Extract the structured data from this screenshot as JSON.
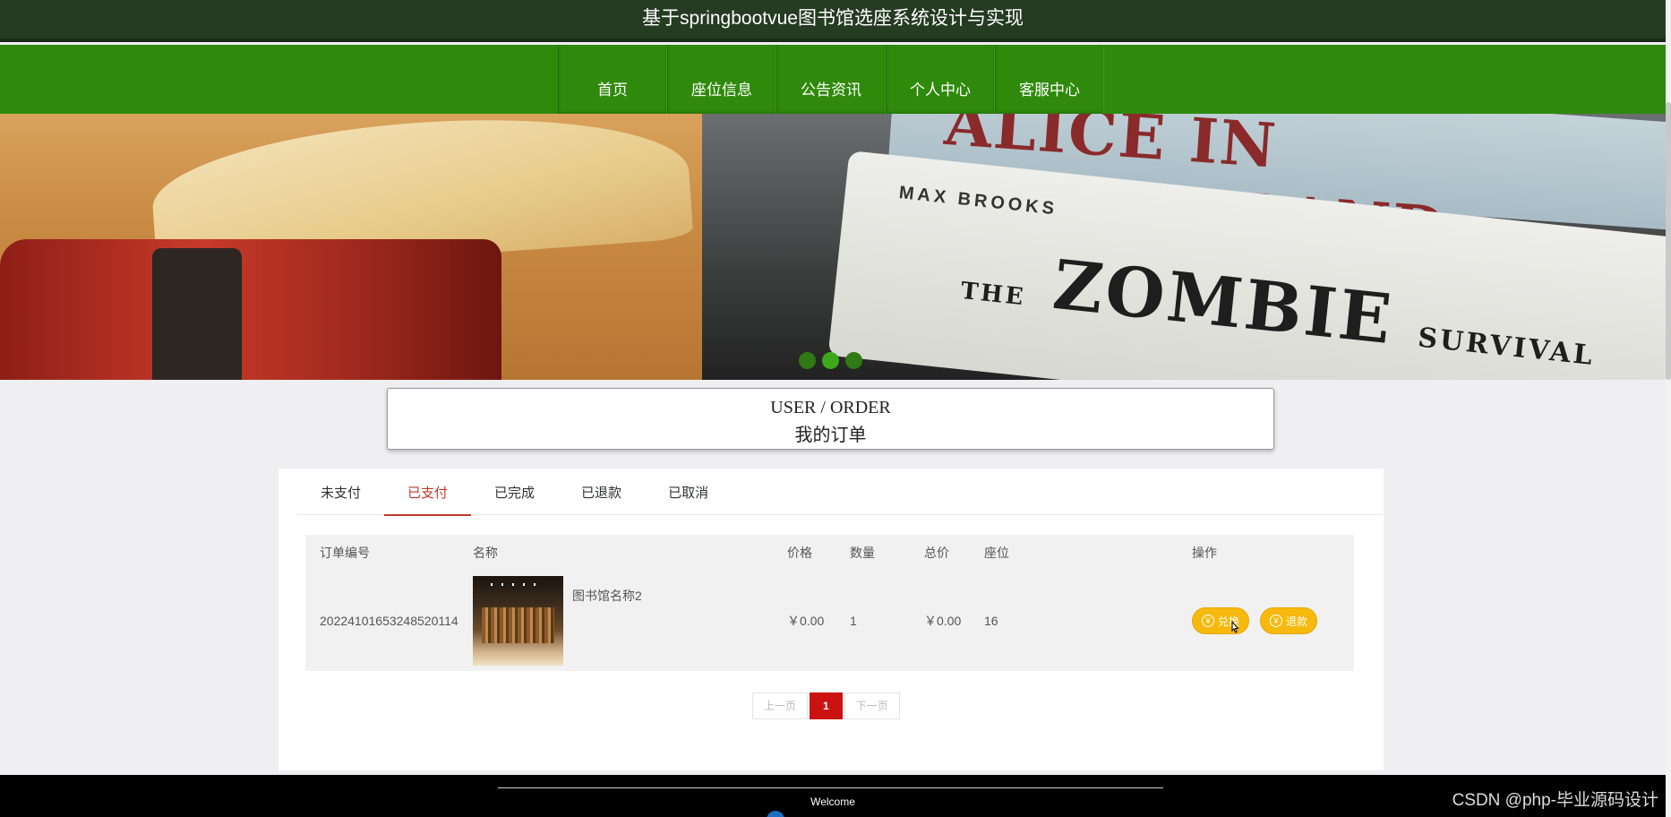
{
  "header": {
    "title": "基于springbootvue图书馆选座系统设计与实现"
  },
  "nav": {
    "items": [
      "首页",
      "座位信息",
      "公告资讯",
      "个人中心",
      "客服中心"
    ]
  },
  "banner": {
    "book_title_1": "ALICE IN ZOMBIELAND",
    "book_author_2": "MAX BROOKS",
    "book_title_2_prefix": "THE",
    "book_title_2": "ZOMBIE",
    "book_title_2_suffix": "SURVIVAL",
    "dots": 3,
    "active_dot": 2
  },
  "section": {
    "en": "USER / ORDER",
    "zh": "我的订单"
  },
  "tabs": {
    "items": [
      "未支付",
      "已支付",
      "已完成",
      "已退款",
      "已取消"
    ],
    "active": "已支付"
  },
  "table": {
    "headers": [
      "订单编号",
      "名称",
      "价格",
      "数量",
      "总价",
      "座位",
      "操作"
    ],
    "rows": [
      {
        "order_no": "20224101653248520114",
        "name": "图书馆名称2",
        "price": "￥0.00",
        "qty": "1",
        "total": "￥0.00",
        "seat": "16",
        "actions": [
          "兑换",
          "退款"
        ]
      }
    ]
  },
  "pagination": {
    "prev": "上一页",
    "current": "1",
    "next": "下一页"
  },
  "footer": {
    "welcome": "Welcome"
  },
  "watermark": "CSDN @php-毕业源码设计",
  "colors": {
    "nav_green": "#2f8a0c",
    "title_dark_green": "#253b22",
    "accent_red": "#c0392b",
    "button_yellow": "#f7b90d"
  }
}
